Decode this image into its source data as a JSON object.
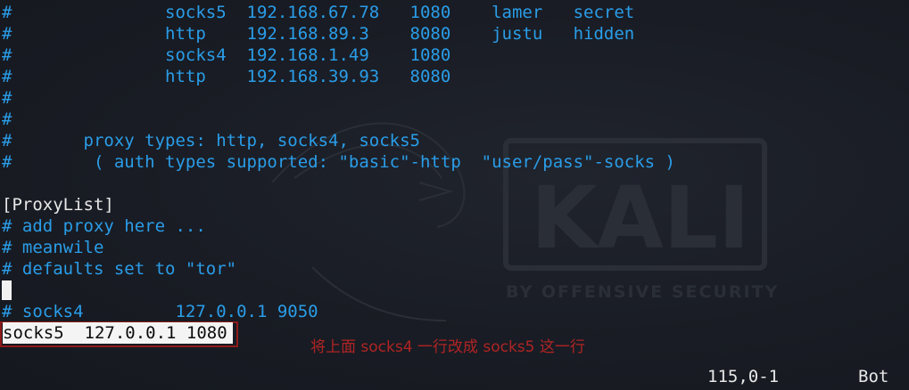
{
  "colors": {
    "background": "#191c24",
    "comment": "#2a9de8",
    "text": "#e8e8e8",
    "annotation_box": "#8d1a1a",
    "annotation_text": "#b02424"
  },
  "watermark": {
    "logo": "KALI",
    "tagline": "BY OFFENSIVE SECURITY"
  },
  "editor_lines": [
    "#               socks5  192.168.67.78   1080    lamer   secret",
    "#               http    192.168.89.3    8080    justu   hidden",
    "#               socks4  192.168.1.49    1080",
    "#               http    192.168.39.93   8080",
    "#",
    "#",
    "#       proxy types: http, socks4, socks5",
    "#        ( auth types supported: \"basic\"-http  \"user/pass\"-socks )",
    "[ProxyList]",
    "# add proxy here ...",
    "# meanwile",
    "# defaults set to \"tor\"",
    "",
    "# socks4         127.0.0.1 9050"
  ],
  "current_line": "socks5  127.0.0.1 1080",
  "annotation": "将上面 socks4 一行改成 socks5 这一行",
  "status_bar": {
    "position": "115,0-1",
    "scroll": "Bot"
  }
}
